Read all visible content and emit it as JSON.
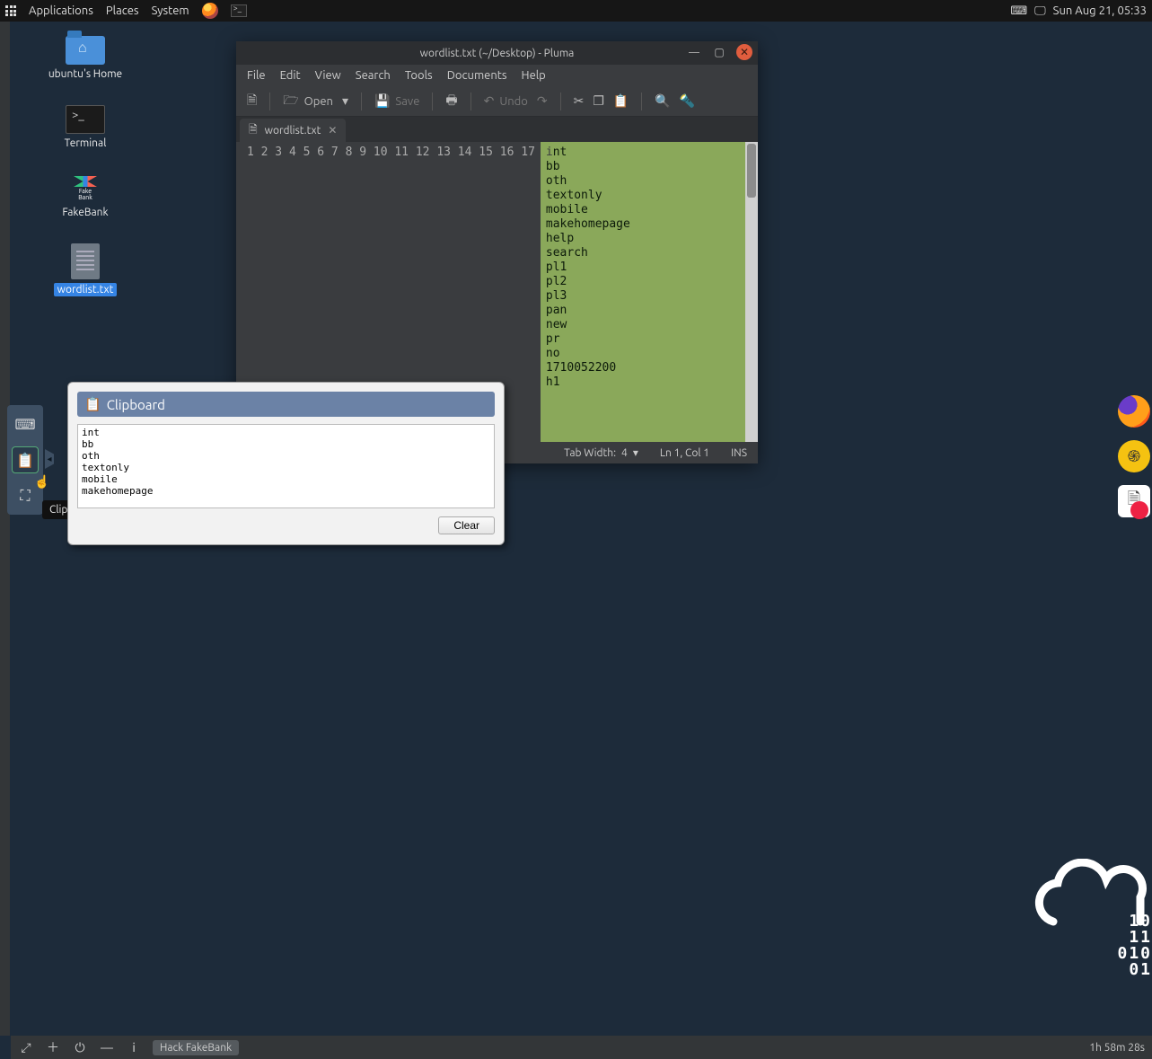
{
  "top_panel": {
    "menus": [
      "Applications",
      "Places",
      "System"
    ],
    "clock": "Sun Aug 21, 05:33"
  },
  "desktop": {
    "icons": [
      {
        "name": "home-folder",
        "label": "ubuntu's Home"
      },
      {
        "name": "terminal",
        "label": "Terminal"
      },
      {
        "name": "fakebank",
        "label": "FakeBank"
      },
      {
        "name": "wordlist",
        "label": "wordlist.txt",
        "selected": true
      }
    ]
  },
  "pluma": {
    "title": "wordlist.txt (~/Desktop) - Pluma",
    "menubar": [
      "File",
      "Edit",
      "View",
      "Search",
      "Tools",
      "Documents",
      "Help"
    ],
    "toolbar": {
      "open": "Open",
      "save": "Save",
      "undo": "Undo"
    },
    "tab": "wordlist.txt",
    "lines": [
      "int",
      "bb",
      "oth",
      "textonly",
      "mobile",
      "makehomepage",
      "help",
      "search",
      "pl1",
      "pl2",
      "pl3",
      "pan",
      "new",
      "pr",
      "no",
      "1710052200",
      "h1"
    ],
    "status": {
      "tab_width_label": "Tab Width:",
      "tab_width_value": "4",
      "position": "Ln 1, Col 1",
      "mode": "INS"
    }
  },
  "side_tray": {
    "tooltip": "Clipboard"
  },
  "clipboard": {
    "title": "Clipboard",
    "content": "int\nbb\noth\ntextonly\nmobile\nmakehomepage",
    "clear": "Clear"
  },
  "cloud_digits": [
    "10",
    "11",
    "010",
    "01"
  ],
  "bottom_bar": {
    "task": "Hack FakeBank",
    "timer": "1h 58m 28s"
  }
}
